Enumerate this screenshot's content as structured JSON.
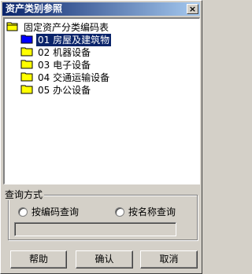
{
  "window": {
    "title": "资产类别参照",
    "close_label": "×"
  },
  "tree": {
    "root_label": "固定资产分类编码表",
    "items": [
      {
        "code": "01",
        "name": "房屋及建筑物",
        "label": "01 房屋及建筑物",
        "selected": true
      },
      {
        "code": "02",
        "name": "机器设备",
        "label": "02 机器设备",
        "selected": false
      },
      {
        "code": "03",
        "name": "电子设备",
        "label": "03 电子设备",
        "selected": false
      },
      {
        "code": "04",
        "name": "交通运输设备",
        "label": "04 交通运输设备",
        "selected": false
      },
      {
        "code": "05",
        "name": "办公设备",
        "label": "05 办公设备",
        "selected": false
      }
    ]
  },
  "query": {
    "group_title": "查询方式",
    "by_code_label": "按编码查询",
    "by_name_label": "按名称查询",
    "input_value": ""
  },
  "buttons": {
    "help": "帮助",
    "ok": "确认",
    "cancel": "取消"
  },
  "colors": {
    "selection": "#0a246a",
    "folder": "#ffff00",
    "window": "#d4d0c8"
  }
}
